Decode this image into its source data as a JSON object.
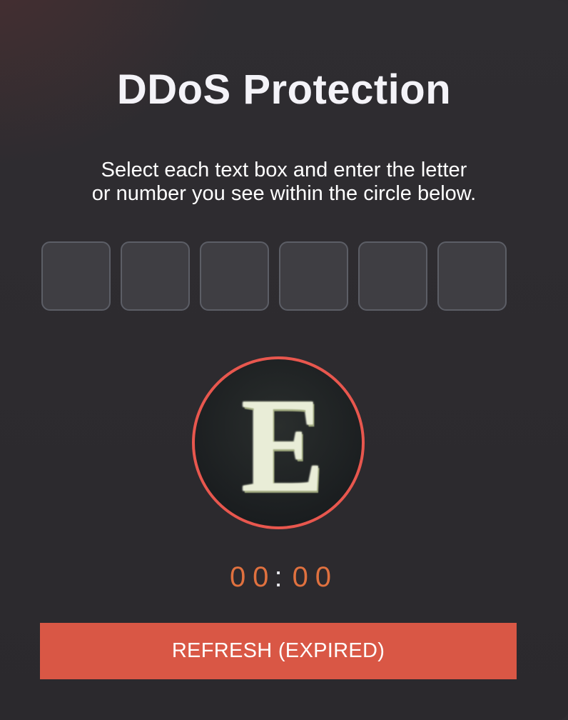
{
  "page": {
    "title": "DDoS Protection",
    "instructions": [
      "Select each text box and enter the letter",
      "or number you see within the circle below."
    ]
  },
  "captcha": {
    "inputs": [
      "",
      "",
      "",
      "",
      "",
      ""
    ],
    "glyph": "E",
    "ring_color": "#e8574e"
  },
  "timer": {
    "minutes": "00",
    "separator": ":",
    "seconds": "00",
    "color": "#e0713f"
  },
  "refresh_button": {
    "label": "REFRESH (EXPIRED)",
    "color": "#d95745"
  }
}
